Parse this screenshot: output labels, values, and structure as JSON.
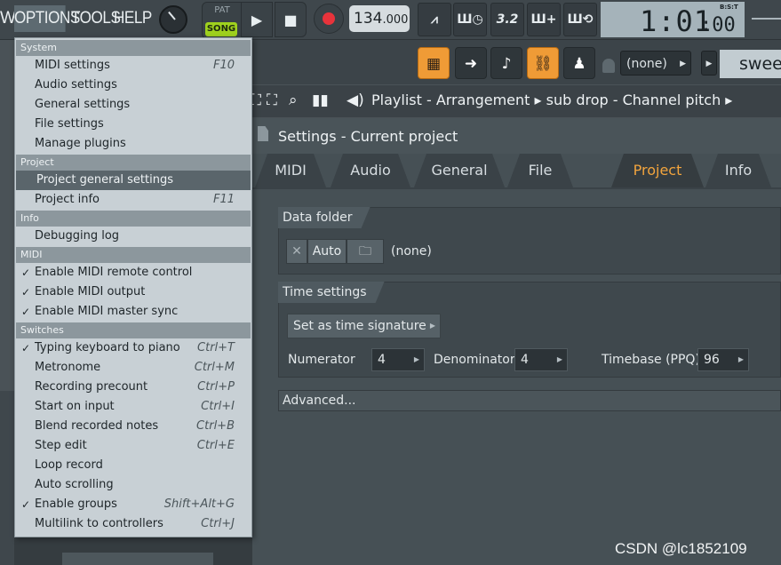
{
  "menubar": {
    "w": "W",
    "options": "OPTIONS",
    "tools": "TOOLS",
    "help": "HELP"
  },
  "transport": {
    "pat": "PAT",
    "song": "SONG",
    "play": "▶",
    "stop": "■",
    "tempo_int": "134",
    "tempo_dec": ".000"
  },
  "tools": [
    {
      "name": "metronome-icon",
      "glyph": "⩘"
    },
    {
      "name": "wait-record-icon",
      "glyph": "Ш◷"
    },
    {
      "name": "countdown-icon",
      "glyph": "3.2"
    },
    {
      "name": "step-edit-icon",
      "glyph": "Ш+"
    },
    {
      "name": "loop-record-icon",
      "glyph": "Ш⟲"
    }
  ],
  "time": {
    "main": "1:01",
    "sub": ":00",
    "format": "B:S:T"
  },
  "row2": {
    "none_dropdown": "(none)",
    "sweep": "sweep"
  },
  "playlist": {
    "title": "Playlist - Arrangement ▸ sub drop - Channel pitch ▸"
  },
  "settings": {
    "title": "Settings - Current project",
    "tabs": [
      "MIDI",
      "Audio",
      "General",
      "File",
      "Project",
      "Info"
    ],
    "active_tab": "Project",
    "data_folder": {
      "label": "Data folder",
      "auto": "Auto",
      "value": "(none)"
    },
    "time_settings": {
      "label": "Time settings",
      "set_signature": "Set as time signature",
      "numerator_label": "Numerator",
      "numerator": "4",
      "denominator_label": "Denominator",
      "denominator": "4",
      "timebase_label": "Timebase (PPQ)",
      "timebase": "96"
    },
    "advanced": "Advanced..."
  },
  "menu": {
    "sections": {
      "system": "System",
      "project": "Project",
      "info": "Info",
      "midi": "MIDI",
      "switches": "Switches"
    },
    "system": [
      {
        "label": "MIDI settings",
        "shortcut": "F10"
      },
      {
        "label": "Audio settings",
        "shortcut": ""
      },
      {
        "label": "General settings",
        "shortcut": ""
      },
      {
        "label": "File settings",
        "shortcut": ""
      },
      {
        "label": "Manage plugins",
        "shortcut": ""
      }
    ],
    "project": [
      {
        "label": "Project general settings",
        "shortcut": ""
      },
      {
        "label": "Project info",
        "shortcut": "F11"
      }
    ],
    "info": [
      {
        "label": "Debugging log",
        "shortcut": ""
      }
    ],
    "midi": [
      {
        "label": "Enable MIDI remote control",
        "checked": "✓"
      },
      {
        "label": "Enable MIDI output",
        "checked": "✓"
      },
      {
        "label": "Enable MIDI master sync",
        "checked": "✓"
      }
    ],
    "switches": [
      {
        "label": "Typing keyboard to piano",
        "shortcut": "Ctrl+T",
        "checked": "✓"
      },
      {
        "label": "Metronome",
        "shortcut": "Ctrl+M",
        "checked": ""
      },
      {
        "label": "Recording precount",
        "shortcut": "Ctrl+P",
        "checked": ""
      },
      {
        "label": "Start on input",
        "shortcut": "Ctrl+I",
        "checked": ""
      },
      {
        "label": "Blend recorded notes",
        "shortcut": "Ctrl+B",
        "checked": ""
      },
      {
        "label": "Step edit",
        "shortcut": "Ctrl+E",
        "checked": ""
      },
      {
        "label": "Loop record",
        "shortcut": "",
        "checked": ""
      },
      {
        "label": "Auto scrolling",
        "shortcut": "",
        "checked": ""
      },
      {
        "label": "Enable groups",
        "shortcut": "Shift+Alt+G",
        "checked": "✓"
      },
      {
        "label": "Multilink to controllers",
        "shortcut": "Ctrl+J",
        "checked": ""
      }
    ]
  },
  "watermark": "CSDN @lc1852109",
  "colors": {
    "accent_orange": "#ef9b36",
    "song_green": "#9fd11e",
    "record_red": "#e8333b",
    "active_tab": "#f2a43d"
  }
}
